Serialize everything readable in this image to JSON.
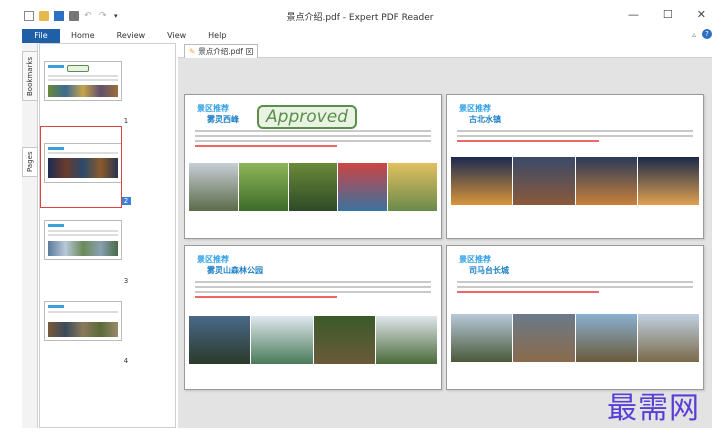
{
  "window": {
    "title": "景点介绍.pdf - Expert PDF Reader",
    "minimize_icon": "—",
    "maximize_icon": "☐",
    "close_icon": "✕"
  },
  "ribbon": {
    "tabs": [
      "File",
      "Home",
      "Review",
      "View",
      "Help"
    ]
  },
  "side_tabs": {
    "bookmarks": "Bookmarks",
    "pages": "Pages"
  },
  "thumbnails": [
    {
      "number": "1"
    },
    {
      "number": "2"
    },
    {
      "number": "3"
    },
    {
      "number": "4"
    }
  ],
  "document_tab": {
    "label": "景点介绍.pdf",
    "close": "x"
  },
  "pages": [
    {
      "category": "景区推荐",
      "name": "雾灵西峰",
      "stamp": "Approved"
    },
    {
      "category": "景区推荐",
      "name": "古北水镇"
    },
    {
      "category": "景区推荐",
      "name": "雾灵山森林公园"
    },
    {
      "category": "景区推荐",
      "name": "司马台长城"
    }
  ],
  "watermark": "最需网",
  "colors": {
    "file_tab": "#1f5fa8",
    "selection": "#e04040",
    "heading_blue": "#2fa1e6",
    "stamp_green": "#5a8f4b"
  }
}
